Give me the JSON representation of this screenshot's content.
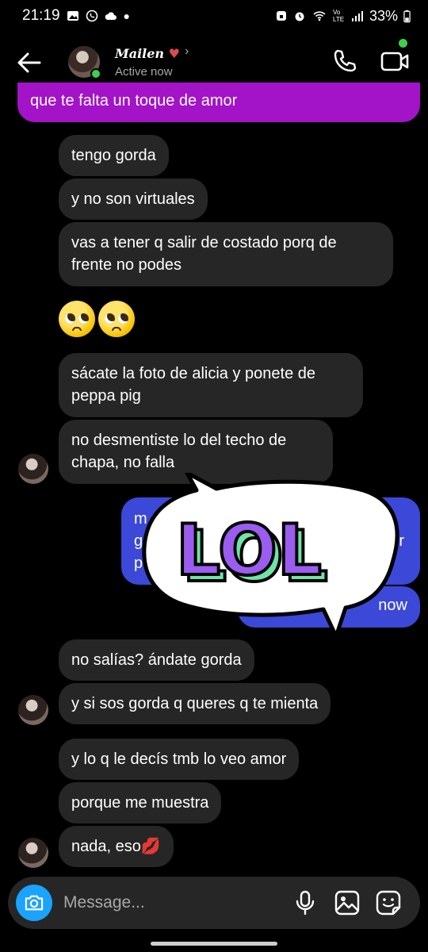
{
  "status_bar": {
    "time": "21:19",
    "network": "Vo LTE",
    "battery": "33%"
  },
  "header": {
    "contact_name": "Mailen",
    "active_status": "Active now",
    "chevron": "›"
  },
  "messages": [
    {
      "text": "que te falta un toque de amor",
      "style": "purple"
    },
    {
      "text": "tengo gorda"
    },
    {
      "text": "y no son virtuales"
    },
    {
      "text": "vas a tener q  salir de costado porq de frente no podes"
    },
    {
      "text": "🥺🥺",
      "emoji": "pleading-face"
    },
    {
      "text": "sácate la foto de alicia y ponete de peppa pig"
    },
    {
      "text": "no desmentiste lo del techo de chapa, no falla"
    },
    {
      "text": "m",
      "partial": true
    },
    {
      "text": "g",
      "partial": true
    },
    {
      "text": "p",
      "partial": true
    },
    {
      "text": "or",
      "partial": true
    },
    {
      "text": "now",
      "partial": true
    },
    {
      "text": "no salías? ándate gorda"
    },
    {
      "text": "y si sos gorda q queres q te mienta"
    },
    {
      "text": "y lo q le decís tmb lo veo amor"
    },
    {
      "text": "porque me muestra"
    },
    {
      "text": "nada, eso💋"
    }
  ],
  "sticker": {
    "text": "LOL",
    "icon": "lol-speech-bubble-sticker"
  },
  "composer": {
    "placeholder": "Message..."
  },
  "colors": {
    "background": "#000000",
    "incoming_bubble": "#262626",
    "outgoing_bubble": "#3b48d8",
    "highlight_bubble": "#a313c7",
    "online": "#3fcf4d",
    "camera_button": "#1aa3ff",
    "sticker_fill": "#9b5cf0",
    "sticker_shadow": "#6fe3a8"
  }
}
